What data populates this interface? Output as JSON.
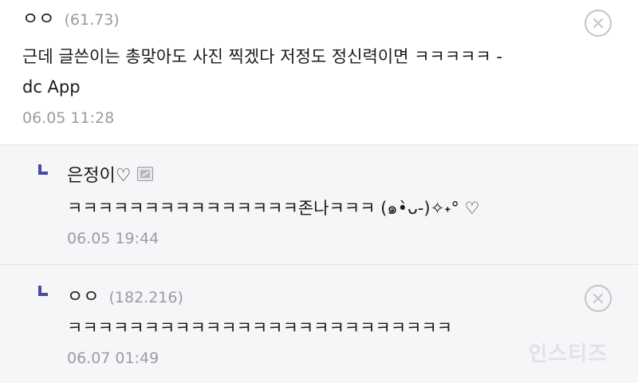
{
  "comments": [
    {
      "nickname": "ㅇㅇ",
      "ip": "(61.73)",
      "text_line1": "근데 글쓴이는 총맞아도 사진 찍겠다 저정도 정신력이면 ㅋㅋㅋㅋㅋ -",
      "text_line2": "dc App",
      "date": "06.05 11:28",
      "delete_icon": "close-circle-icon"
    },
    {
      "nickname": "은정이♡",
      "text": "ㅋㅋㅋㅋㅋㅋㅋㅋㅋㅋㅋㅋㅋㅋㅋ존나ㅋㅋㅋ (๑•̀ᴗ-)✧˖° ♡",
      "date": "06.05 19:44",
      "reply_icon": "reply-arrow-icon",
      "badge_icon": "gallog-icon"
    },
    {
      "nickname": "ㅇㅇ",
      "ip": "(182.216)",
      "text": "ㅋㅋㅋㅋㅋㅋㅋㅋㅋㅋㅋㅋㅋㅋㅋㅋㅋㅋㅋㅋㅋㅋㅋㅋㅋ",
      "date": "06.07 01:49",
      "reply_icon": "reply-arrow-icon",
      "delete_icon": "close-circle-icon"
    }
  ],
  "watermark": "인스티즈",
  "colors": {
    "reply_marker": "#4b4ba3",
    "meta_gray": "#9b9ba3",
    "reply_background": "#f6f6f8"
  }
}
